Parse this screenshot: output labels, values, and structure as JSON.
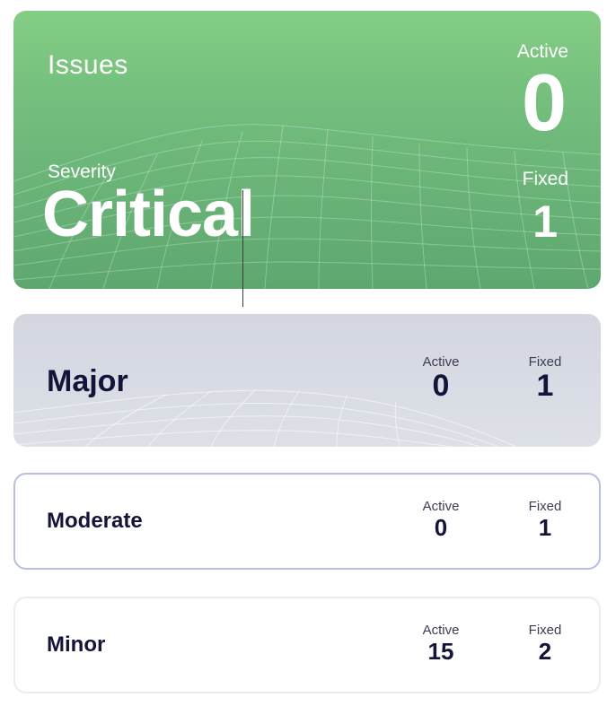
{
  "critical": {
    "title": "Issues",
    "severity_label": "Severity",
    "level": "Critical",
    "active_label": "Active",
    "active_value": "0",
    "fixed_label": "Fixed",
    "fixed_value": "1",
    "accent_color": "#6fb97b"
  },
  "rows": [
    {
      "level": "Major",
      "active_label": "Active",
      "active_value": "0",
      "fixed_label": "Fixed",
      "fixed_value": "1"
    },
    {
      "level": "Moderate",
      "active_label": "Active",
      "active_value": "0",
      "fixed_label": "Fixed",
      "fixed_value": "1"
    },
    {
      "level": "Minor",
      "active_label": "Active",
      "active_value": "15",
      "fixed_label": "Fixed",
      "fixed_value": "2"
    }
  ]
}
